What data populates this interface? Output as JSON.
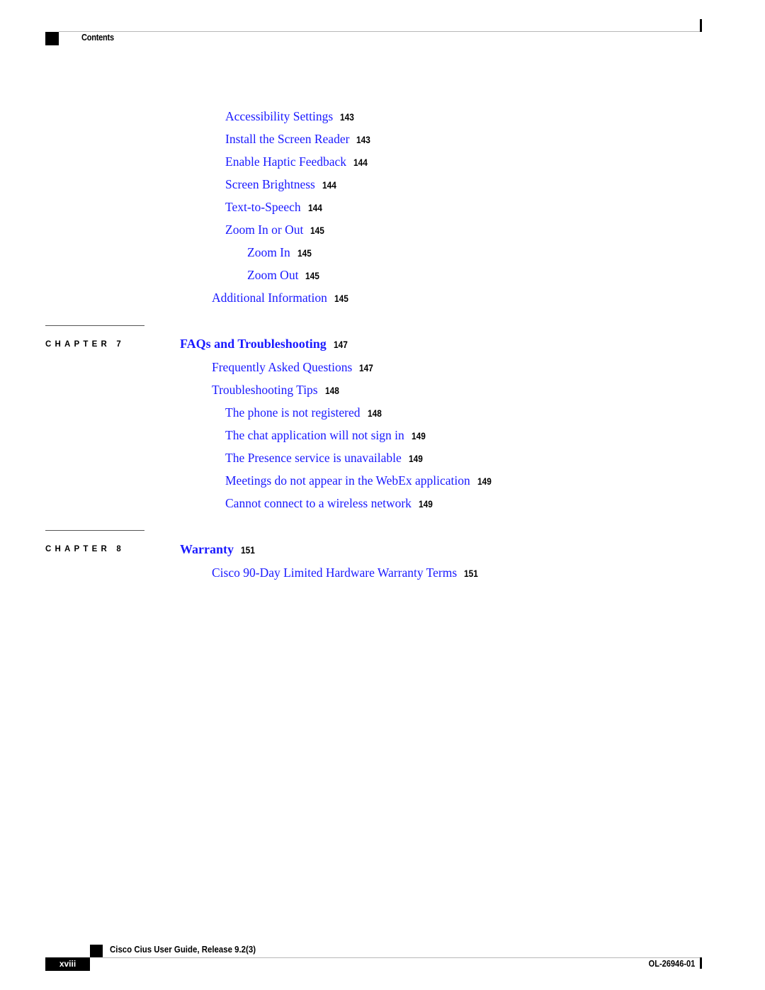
{
  "header": {
    "section_label": "Contents"
  },
  "toc": {
    "entries_top": [
      {
        "title": "Accessibility Settings",
        "page": "143",
        "level": 2
      },
      {
        "title": "Install the Screen Reader",
        "page": "143",
        "level": 2
      },
      {
        "title": "Enable Haptic Feedback",
        "page": "144",
        "level": 2
      },
      {
        "title": "Screen Brightness",
        "page": "144",
        "level": 2
      },
      {
        "title": "Text-to-Speech",
        "page": "144",
        "level": 2
      },
      {
        "title": "Zoom In or Out",
        "page": "145",
        "level": 2
      },
      {
        "title": "Zoom In",
        "page": "145",
        "level": 3
      },
      {
        "title": "Zoom Out",
        "page": "145",
        "level": 3
      },
      {
        "title": "Additional Information",
        "page": "145",
        "level": 1
      }
    ],
    "chapters": [
      {
        "label": "CHAPTER 7",
        "title": "FAQs and Troubleshooting",
        "page": "147",
        "entries": [
          {
            "title": "Frequently Asked Questions",
            "page": "147",
            "level": 1
          },
          {
            "title": "Troubleshooting Tips",
            "page": "148",
            "level": 1
          },
          {
            "title": "The phone is not registered",
            "page": "148",
            "level": 2
          },
          {
            "title": "The chat application will not sign in",
            "page": "149",
            "level": 2
          },
          {
            "title": "The Presence service is unavailable",
            "page": "149",
            "level": 2
          },
          {
            "title": "Meetings do not appear in the WebEx application",
            "page": "149",
            "level": 2
          },
          {
            "title": "Cannot connect to a wireless network",
            "page": "149",
            "level": 2
          }
        ]
      },
      {
        "label": "CHAPTER 8",
        "title": "Warranty",
        "page": "151",
        "entries": [
          {
            "title": "Cisco 90-Day Limited Hardware Warranty Terms",
            "page": "151",
            "level": 1
          }
        ]
      }
    ]
  },
  "footer": {
    "book_title": "Cisco Cius User Guide, Release 9.2(3)",
    "page_number": "xviii",
    "doc_number": "OL-26946-01"
  },
  "colors": {
    "link": "#1a1aff",
    "text": "#000000"
  }
}
